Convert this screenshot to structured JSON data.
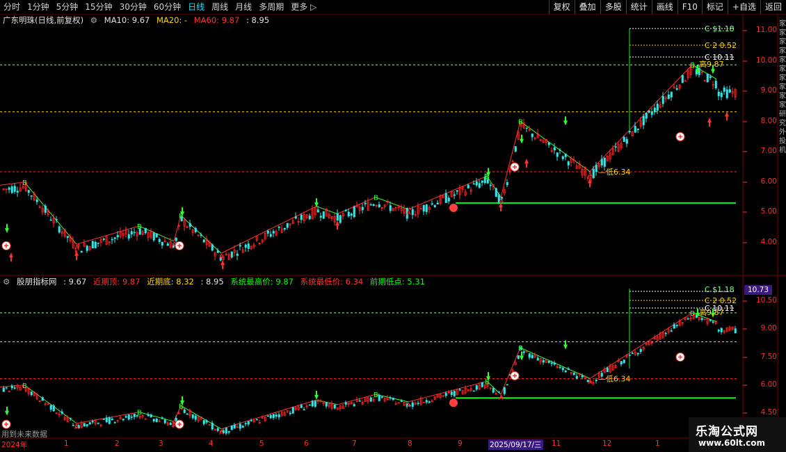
{
  "toolbar": {
    "periods": [
      "分时",
      "1分钟",
      "5分钟",
      "15分钟",
      "30分钟",
      "60分钟",
      "日线",
      "周线",
      "月线",
      "多周期",
      "更多 ▷"
    ],
    "active_period": "日线",
    "buttons": [
      "复权",
      "叠加",
      "多股",
      "统计",
      "画线",
      "F10",
      "标记",
      "+自选",
      "返回"
    ]
  },
  "main_legend": {
    "stock_name": "广东明珠(日线,前复权)",
    "ma10": "MA10: 9.67",
    "ma20": "MA20: -",
    "ma60": "MA60: 9.87",
    "extra": ": 8.95"
  },
  "sub_legend": {
    "indicator": "股朋指标网",
    "v1": ": 9.67",
    "recent_top": "近期顶: 9.87",
    "recent_bottom": "近期底: 8.32",
    "v2": ": 8.95",
    "sys_high": "系统最高价: 9.87",
    "sys_low": "系统最低价: 6.34",
    "prev_low": "前期低点: 5.31"
  },
  "main_y_ticks": [
    "11.00",
    "10.00",
    "9.00",
    "8.00",
    "7.00",
    "6.00",
    "5.00",
    "4.00"
  ],
  "sub_y_ticks": [
    "10.50",
    "9.00",
    "7.50",
    "6.00",
    "4.50"
  ],
  "sub_y_highlight": "10.73",
  "x_axis": [
    "2024年",
    "1",
    "2",
    "3",
    "4",
    "5",
    "6",
    "7",
    "8",
    "9",
    "2025/09/17/三",
    "11",
    "12",
    "1"
  ],
  "annotations": {
    "c1": "C $1.18",
    "c2": "C 2 0.52",
    "c3": "C 10.11",
    "high_main": "高9.87",
    "low_main": "低6.34",
    "high_sub": "高9.87",
    "low_sub": "低6.34"
  },
  "future_data_note": "用到未来数据",
  "right_side_text": "家家家家家家家家家家研究外投机",
  "logo": {
    "name": "乐淘公式网",
    "url": "www.60lt.com"
  },
  "colors": {
    "up": "#ff3030",
    "down": "#40e0e0",
    "axis": "#ff3030",
    "grid": "#5a0000"
  }
}
